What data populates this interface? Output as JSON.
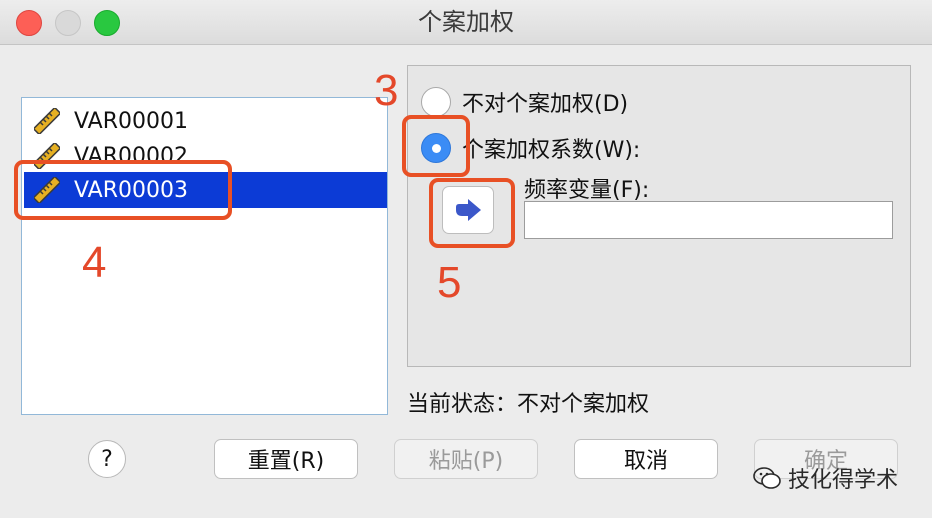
{
  "window": {
    "title": "个案加权"
  },
  "variables": [
    {
      "name": "VAR00001",
      "selected": false
    },
    {
      "name": "VAR00002",
      "selected": false
    },
    {
      "name": "VAR00003",
      "selected": true
    }
  ],
  "weight_options": {
    "no_weight_label": "不对个案加权(D)",
    "weight_by_label": "个案加权系数(W):",
    "selected": "weight_by",
    "frequency_label": "频率变量(F):",
    "frequency_value": ""
  },
  "status": {
    "label": "当前状态：",
    "value": "不对个案加权"
  },
  "buttons": {
    "help": "?",
    "reset": "重置(R)",
    "paste": "粘贴(P)",
    "cancel": "取消",
    "ok": "确定"
  },
  "annotations": [
    "3",
    "4",
    "5"
  ],
  "watermark": "技化得学术",
  "colors": {
    "selection": "#0c3bd6",
    "radio_active": "#3b8cf5",
    "annotation": "#e85025",
    "arrow": "#3b57c9"
  }
}
